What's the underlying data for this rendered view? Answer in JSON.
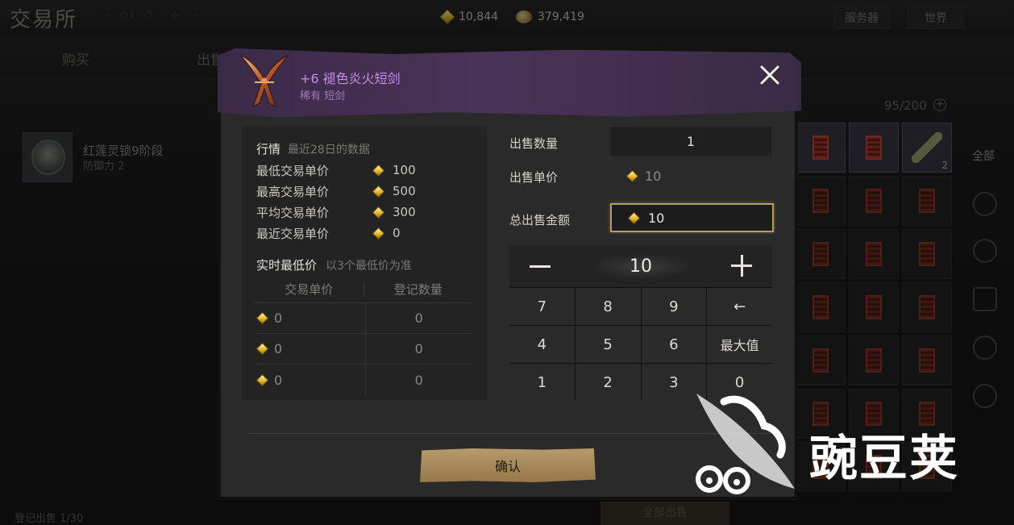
{
  "header": {
    "title": "交易所",
    "title_ornament": "· ঃ ঁ ⊹ ·",
    "currency_gems": "10,844",
    "currency_coins": "379,419",
    "server_tab": "服务器",
    "world_tab": "世界"
  },
  "nav": {
    "buy_tab": "购买",
    "sell_tab": "出售"
  },
  "listing": {
    "item_name": "红莲灵锁9阶段",
    "item_stat": "防御力 2",
    "footer": "登记出售 1/30"
  },
  "inventory": {
    "capacity": "95/200",
    "filter_all": "全部",
    "slot_qty": "2",
    "bottom_button": "全部出售"
  },
  "modal": {
    "item_name": "+6 褪色炎火短剑",
    "item_type": "稀有 短剑",
    "market": {
      "title": "行情",
      "subtitle": "最近28日的数据",
      "stats": [
        {
          "label": "最低交易单价",
          "value": "100"
        },
        {
          "label": "最高交易单价",
          "value": "500"
        },
        {
          "label": "平均交易单价",
          "value": "300"
        },
        {
          "label": "最近交易单价",
          "value": "0"
        }
      ],
      "realtime_title": "实时最低价",
      "realtime_sub": "以3个最低价为准",
      "col_price": "交易单价",
      "col_count": "登记数量",
      "rows": [
        {
          "price": "0",
          "count": "0"
        },
        {
          "price": "0",
          "count": "0"
        },
        {
          "price": "0",
          "count": "0"
        }
      ]
    },
    "sell": {
      "qty_label": "出售数量",
      "qty_value": "1",
      "unit_label": "出售单价",
      "unit_value": "10",
      "total_label": "总出售金额",
      "total_value": "10"
    },
    "keypad": {
      "value": "10",
      "keys": [
        "7",
        "8",
        "9",
        "←",
        "4",
        "5",
        "6",
        "最大值",
        "1",
        "2",
        "3",
        "0"
      ]
    },
    "confirm_label": "确认"
  },
  "watermark": "豌豆荚",
  "colors": {
    "rare_purple": "#c88be8",
    "gold_accent": "#b89a62",
    "gem_yellow": "#e3b92e"
  }
}
